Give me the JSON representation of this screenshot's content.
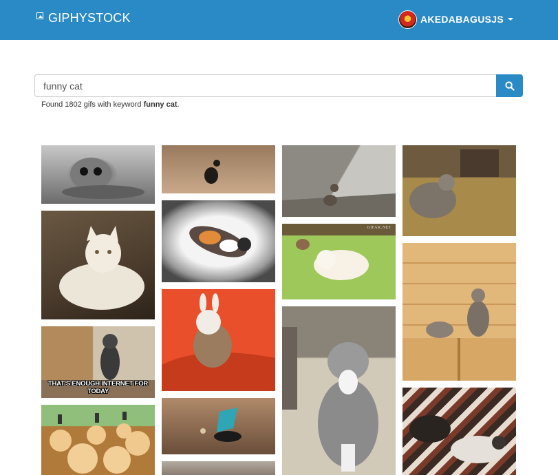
{
  "header": {
    "brand": "GIPHYSTOCK",
    "username": "AKEDABAGUSJS"
  },
  "search": {
    "query": "funny cat",
    "result_prefix": "Found 1802 gifs with keyword ",
    "result_keyword": "funny cat",
    "result_suffix": "."
  },
  "gifs": {
    "col2_item4_caption": "THAT'S ENOUGH INTERNET FOR TODAY",
    "col3_item2_watermark": "GIFAK.NET"
  },
  "colors": {
    "navbar": "#2a8ac6",
    "accent": "#2a8ac6"
  }
}
